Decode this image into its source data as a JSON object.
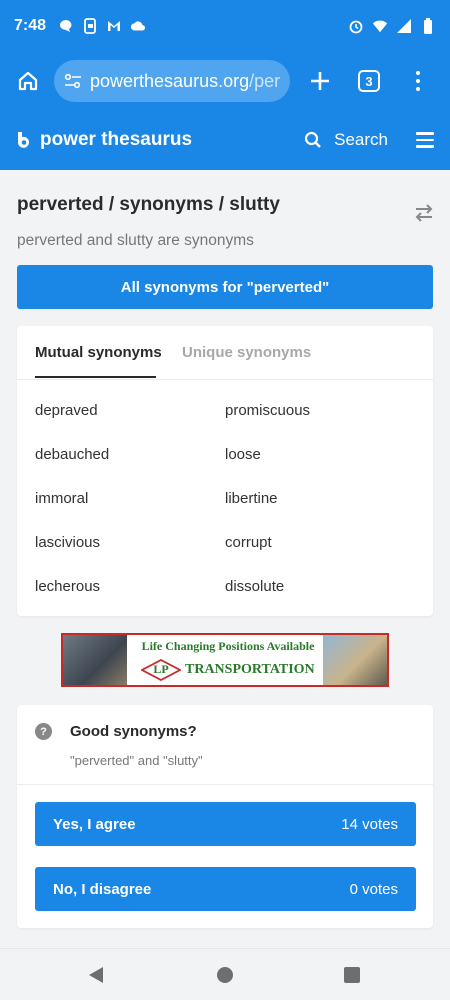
{
  "status_bar": {
    "time": "7:48",
    "left_icons": [
      "chat-bubble-icon",
      "phone-lock-icon",
      "gmail-icon",
      "cloud-icon"
    ],
    "right_icons": [
      "alarm-icon",
      "wifi-icon",
      "signal-icon",
      "battery-icon"
    ]
  },
  "browser": {
    "url_main": "powerthesaurus.org",
    "url_rest": "/per",
    "tab_count": "3"
  },
  "site_header": {
    "logo_text": "power thesaurus",
    "search_label": "Search"
  },
  "page": {
    "title": "perverted / synonyms / slutty",
    "subtitle": "perverted and slutty are synonyms",
    "all_synonyms_button": "All synonyms for \"perverted\""
  },
  "synonyms_card": {
    "tabs": [
      {
        "label": "Mutual synonyms",
        "active": true
      },
      {
        "label": "Unique synonyms",
        "active": false
      }
    ],
    "left_column": [
      "depraved",
      "debauched",
      "immoral",
      "lascivious",
      "lecherous"
    ],
    "right_column": [
      "promiscuous",
      "loose",
      "libertine",
      "corrupt",
      "dissolute"
    ]
  },
  "ad": {
    "line1": "Life Changing Positions Available",
    "logo_text": "LP",
    "line2": "TRANSPORTATION"
  },
  "vote_card": {
    "question": "Good synonyms?",
    "pair": "\"perverted\" and \"slutty\"",
    "agree_label": "Yes, I agree",
    "agree_votes": "14 votes",
    "disagree_label": "No, I disagree",
    "disagree_votes": "0 votes"
  },
  "colors": {
    "brand_blue": "#1a86e5",
    "ad_green": "#2a7a2a",
    "ad_red": "#c82a2a"
  }
}
